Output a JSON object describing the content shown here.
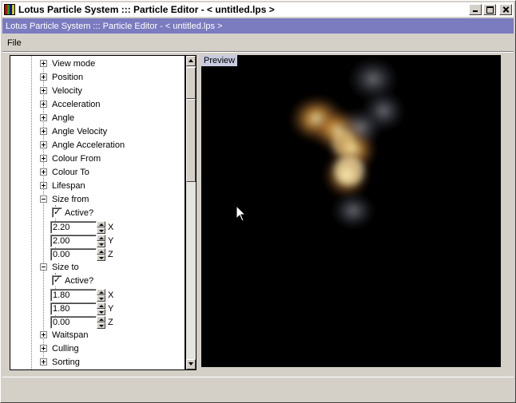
{
  "window": {
    "title": "Lotus Particle System ::: Particle Editor - < untitled.lps >"
  },
  "subbar": {
    "title": "Lotus Particle System ::: Particle Editor - < untitled.lps >"
  },
  "menu": {
    "file": "File"
  },
  "tree": {
    "items_top": [
      {
        "label": "View mode",
        "state": "collapsed"
      },
      {
        "label": "Position",
        "state": "collapsed"
      },
      {
        "label": "Velocity",
        "state": "collapsed"
      },
      {
        "label": "Acceleration",
        "state": "collapsed"
      },
      {
        "label": "Angle",
        "state": "collapsed"
      },
      {
        "label": "Angle Velocity",
        "state": "collapsed"
      },
      {
        "label": "Angle Acceleration",
        "state": "collapsed"
      },
      {
        "label": "Colour From",
        "state": "collapsed"
      },
      {
        "label": "Colour To",
        "state": "collapsed"
      },
      {
        "label": "Lifespan",
        "state": "collapsed"
      }
    ],
    "size_from": {
      "label": "Size from",
      "active_label": "Active?",
      "active": true,
      "x": "2.20",
      "y": "2.00",
      "z": "0.00"
    },
    "size_to": {
      "label": "Size to",
      "active_label": "Active?",
      "active": true,
      "x": "1.80",
      "y": "1.80",
      "z": "0.00"
    },
    "axis_labels": {
      "x": "X",
      "y": "Y",
      "z": "Z"
    },
    "items_bottom": [
      {
        "label": "Waitspan",
        "state": "collapsed"
      },
      {
        "label": "Culling",
        "state": "collapsed"
      },
      {
        "label": "Sorting",
        "state": "collapsed"
      }
    ],
    "check_mark": "✓"
  },
  "preview": {
    "label": "Preview",
    "background": "#000000"
  },
  "colors": {
    "subbar": "#7b7bc0",
    "face": "#d4d0c8"
  }
}
